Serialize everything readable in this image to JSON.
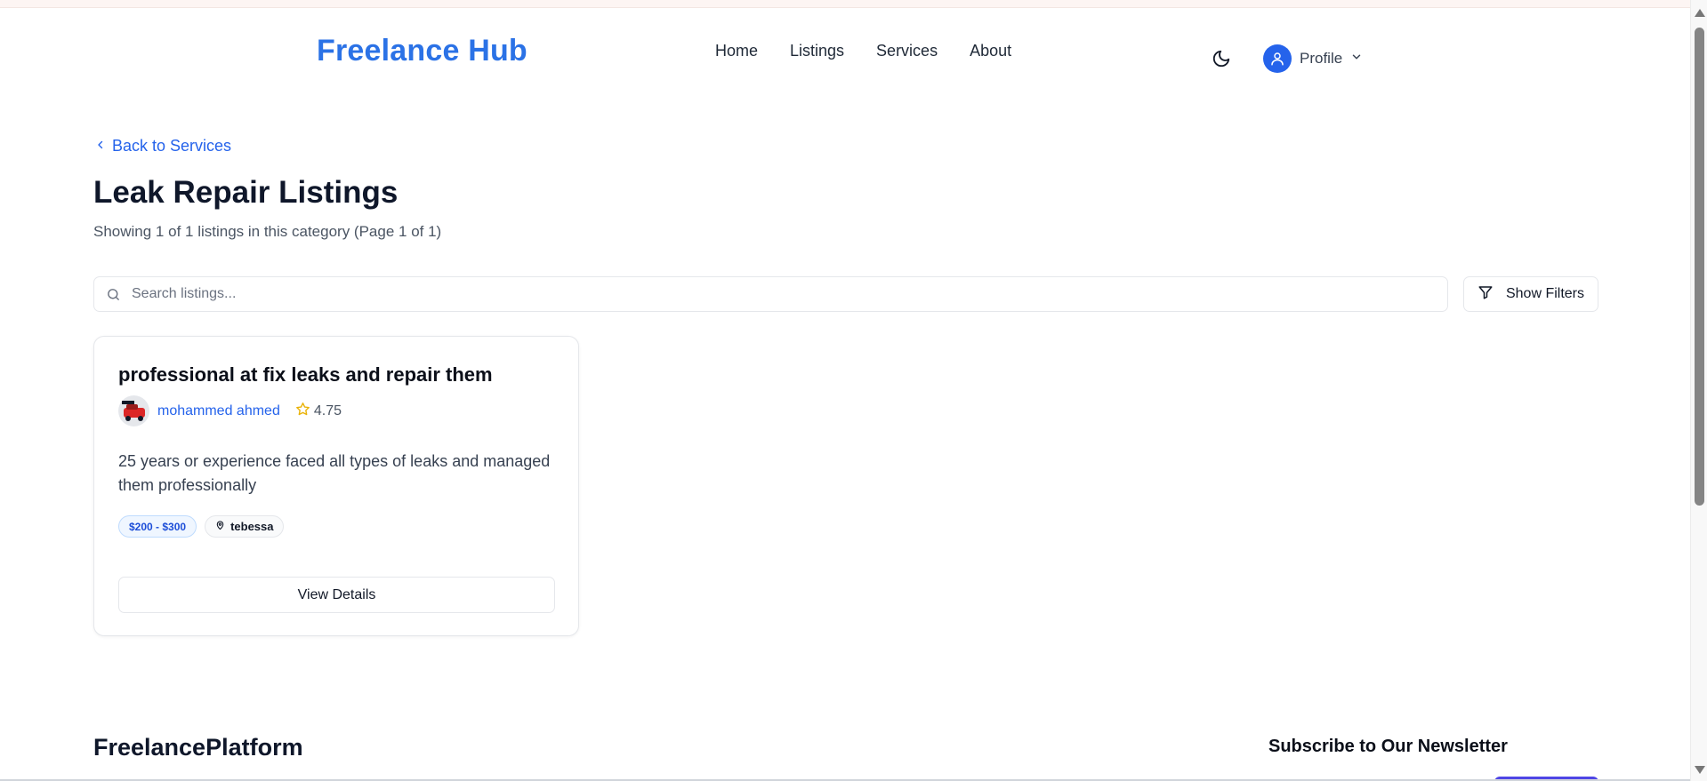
{
  "header": {
    "logo": "Freelance Hub",
    "nav": [
      "Home",
      "Listings",
      "Services",
      "About"
    ],
    "theme_icon": "moon-icon",
    "profile_label": "Profile",
    "profile_icon": "user-icon",
    "profile_chevron": "chevron-down-icon"
  },
  "main": {
    "back_link": "Back to Services",
    "title": "Leak Repair Listings",
    "subtitle": "Showing 1 of 1 listings in this category (Page 1 of 1)",
    "search": {
      "placeholder": "Search listings...",
      "value": ""
    },
    "filters_button": "Show Filters"
  },
  "listings": [
    {
      "title": "professional at fix leaks and repair them",
      "author": "mohammed ahmed",
      "rating": "4.75",
      "description": "25 years or experience faced all types of leaks and managed them professionally",
      "price": "$200 - $300",
      "location": "tebessa",
      "action": "View Details"
    }
  ],
  "footer": {
    "brand": "FreelancePlatform",
    "newsletter_title": "Subscribe to Our Newsletter"
  },
  "colors": {
    "brand": "#2b72e6",
    "link": "#2563eb",
    "star": "#eab308",
    "subscribe": "#4f46e5"
  }
}
